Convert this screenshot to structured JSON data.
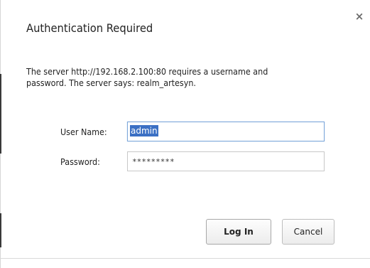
{
  "dialog": {
    "title": "Authentication Required",
    "close_icon": "close-icon",
    "close_glyph": "×",
    "message_line1": "The server http://192.168.2.100:80 requires a username and",
    "message_line2": "password. The server says: realm_artesyn."
  },
  "form": {
    "username_label": "User Name:",
    "username_value": "admin",
    "password_label": "Password:",
    "password_mask": "*********"
  },
  "buttons": {
    "login_label": "Log In",
    "cancel_label": "Cancel"
  },
  "colors": {
    "selection": "#3b70c4",
    "focus_border": "#7da7d9",
    "text": "#222222"
  }
}
